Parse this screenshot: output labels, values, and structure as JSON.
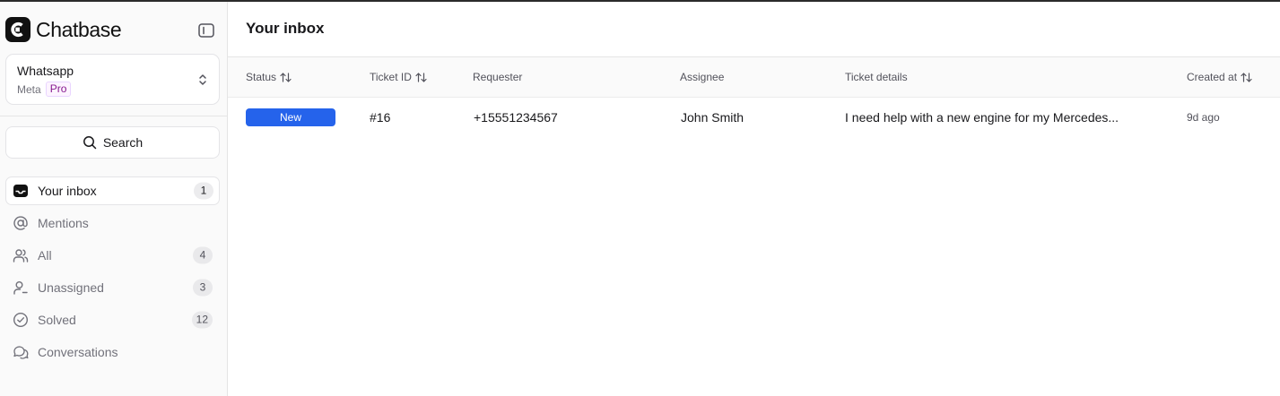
{
  "app": {
    "name": "Chatbase"
  },
  "agent": {
    "name": "Whatsapp",
    "provider": "Meta",
    "plan_badge": "Pro"
  },
  "search": {
    "label": "Search"
  },
  "nav": {
    "items": [
      {
        "label": "Your inbox",
        "count": "1",
        "icon": "inbox-icon",
        "active": true
      },
      {
        "label": "Mentions",
        "count": "",
        "icon": "at-sign-icon"
      },
      {
        "label": "All",
        "count": "4",
        "icon": "users-icon"
      },
      {
        "label": "Unassigned",
        "count": "3",
        "icon": "user-unassigned-icon"
      },
      {
        "label": "Solved",
        "count": "12",
        "icon": "check-circle-icon"
      },
      {
        "label": "Conversations",
        "count": "",
        "icon": "chat-bubbles-icon"
      }
    ]
  },
  "page": {
    "title": "Your inbox"
  },
  "table": {
    "columns": {
      "status": "Status",
      "ticket_id": "Ticket ID",
      "requester": "Requester",
      "assignee": "Assignee",
      "ticket_details": "Ticket details",
      "created_at": "Created at"
    },
    "rows": [
      {
        "status": "New",
        "ticket_id": "#16",
        "requester": "+15551234567",
        "assignee": "John Smith",
        "ticket_details": "I need help with a new engine for my Mercedes...",
        "created_at": "9d ago"
      }
    ]
  },
  "colors": {
    "accent": "#2563eb",
    "pro_text": "#86198f",
    "sidebar_bg": "#fafafa"
  }
}
